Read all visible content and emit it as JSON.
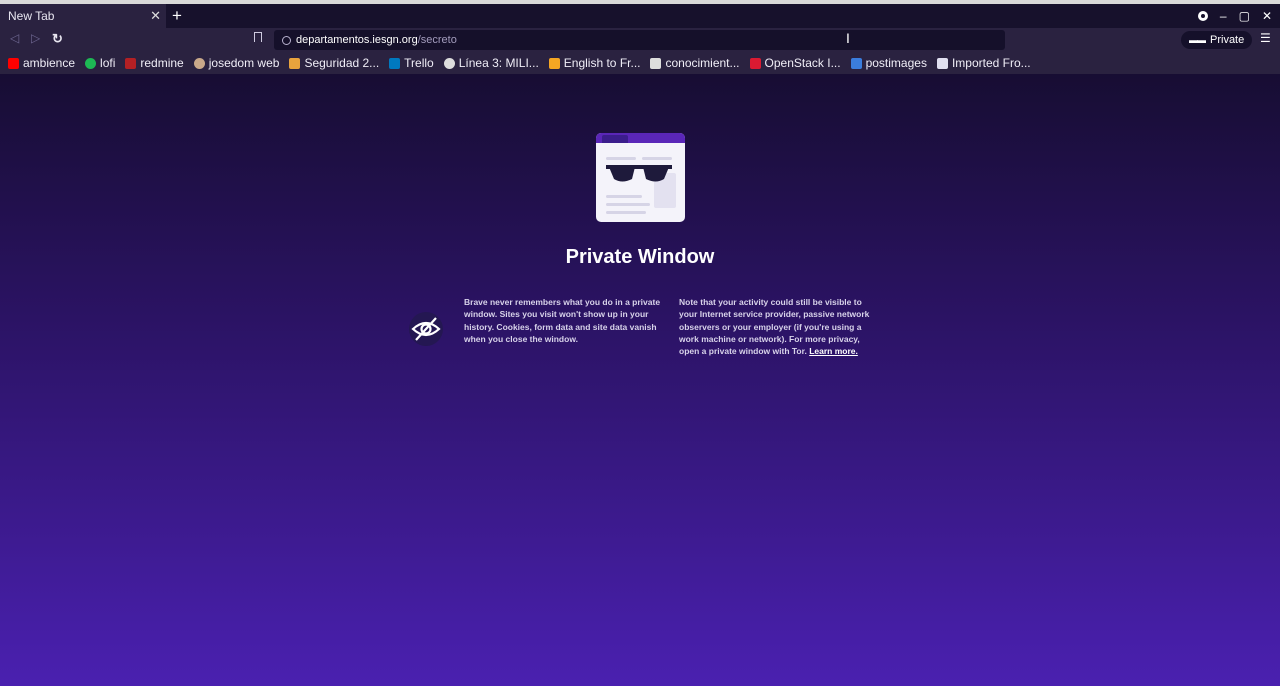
{
  "tabs": [
    {
      "label": "New Tab",
      "close_glyph": "✕"
    }
  ],
  "new_tab_glyph": "+",
  "window_controls": {
    "minimize": "–",
    "maximize": "▢",
    "close": "✕"
  },
  "address": {
    "domain": "departamentos.iesgn.org",
    "path": "/secreto"
  },
  "private_badge": {
    "label": "Private",
    "icon": "glasses-icon"
  },
  "menu_glyph": "☰",
  "bookmarks": [
    {
      "label": "ambience",
      "icon": "youtube-icon",
      "color": "#ff0000"
    },
    {
      "label": "lofi",
      "icon": "spotify-icon",
      "color": "#1db954"
    },
    {
      "label": "redmine",
      "icon": "redmine-icon",
      "color": "#b32024"
    },
    {
      "label": "josedom web",
      "icon": "avatar-icon",
      "color": "#c9a98a"
    },
    {
      "label": "Seguridad 2...",
      "icon": "site-icon",
      "color": "#e8a33d"
    },
    {
      "label": "Trello",
      "icon": "trello-icon",
      "color": "#0079bf"
    },
    {
      "label": "Línea 3: MILI...",
      "icon": "globe-icon",
      "color": "#dddddd"
    },
    {
      "label": "English to Fr...",
      "icon": "translate-icon",
      "color": "#f5a623"
    },
    {
      "label": "conocimient...",
      "icon": "site-icon",
      "color": "#dddddd"
    },
    {
      "label": "OpenStack I...",
      "icon": "openstack-icon",
      "color": "#da1a32"
    },
    {
      "label": "postimages",
      "icon": "postimages-icon",
      "color": "#3b7ddd"
    },
    {
      "label": "Imported Fro...",
      "icon": "folder-icon",
      "color": "#e0dff0"
    }
  ],
  "page": {
    "title": "Private Window",
    "col1": "Brave never remembers what you do in a private window. Sites you visit won't show up in your history. Cookies, form data and site data vanish when you close the window.",
    "col2_text": "Note that your activity could still be visible to your Internet service provider, passive network observers or your employer (if you're using a work machine or network). For more privacy, open a private window with Tor.",
    "col2_link": "Learn more."
  }
}
